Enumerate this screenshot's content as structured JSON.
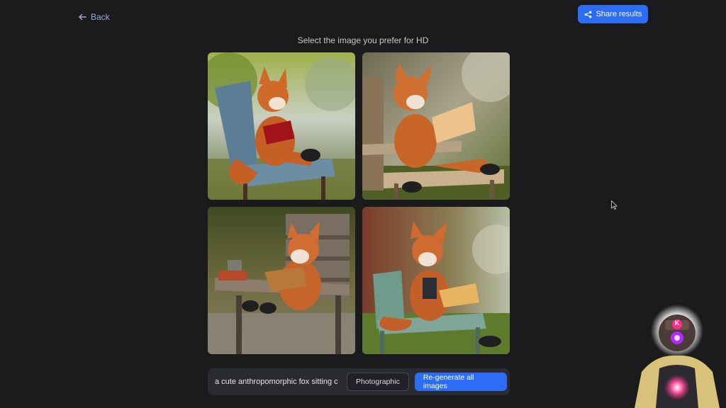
{
  "nav": {
    "back_label": "Back"
  },
  "header": {
    "share_label": "Share results"
  },
  "main": {
    "title": "Select the image you prefer for HD"
  },
  "images": [
    {
      "subject": "fox reading red book in blue lounge chair"
    },
    {
      "subject": "fox reading book on wooden deck chair"
    },
    {
      "subject": "fox reading book on wooden rocking chair"
    },
    {
      "subject": "fox in suit reading book on green chair"
    }
  ],
  "prompt_bar": {
    "prompt_value": "a cute anthropomorphic fox sitting c",
    "style_label": "Photographic",
    "regenerate_label": "Re-generate all images"
  },
  "avatar": {
    "badge_letter": "K"
  },
  "colors": {
    "accent": "#2d6cf5",
    "background": "#1b1b1d"
  }
}
